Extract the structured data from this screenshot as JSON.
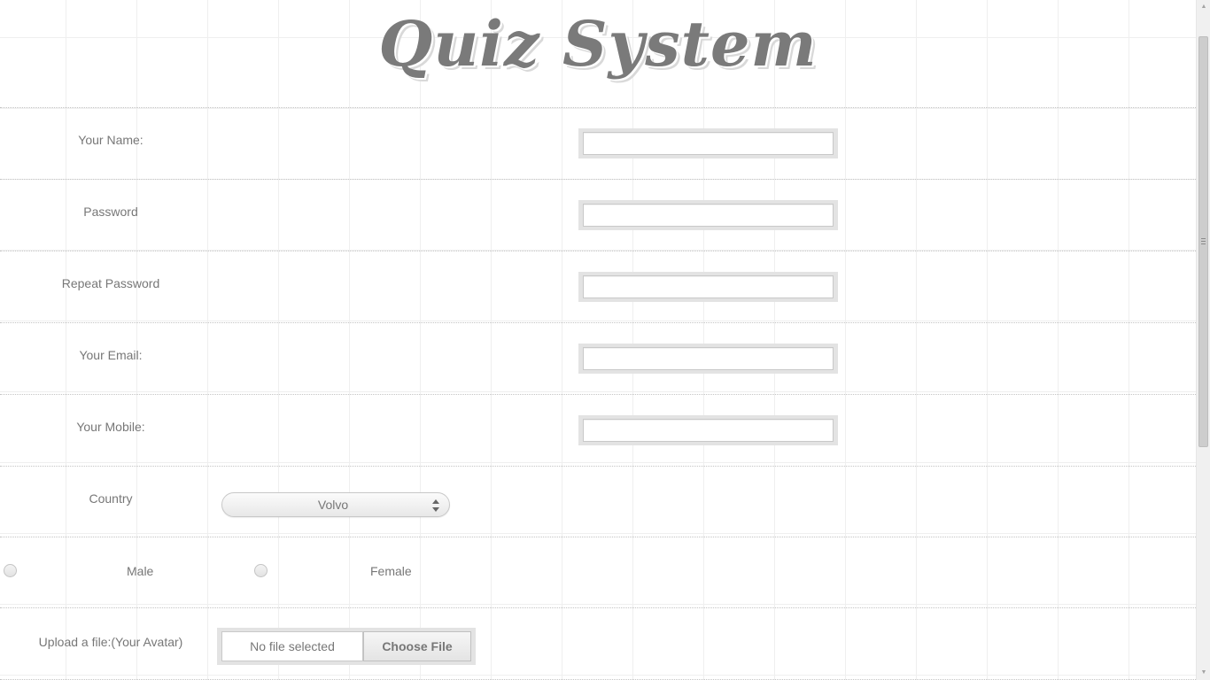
{
  "header": {
    "title": "Quiz System"
  },
  "form": {
    "name_label": "Your Name:",
    "name_value": "",
    "password_label": "Password",
    "password_value": "",
    "repeat_password_label": "Repeat Password",
    "repeat_password_value": "",
    "email_label": "Your Email:",
    "email_value": "",
    "mobile_label": "Your Mobile:",
    "mobile_value": "",
    "country_label": "Country",
    "country_selected": "Volvo",
    "gender_options": [
      "Male",
      "Female"
    ],
    "gender_selected": null,
    "upload_label": "Upload a file:(Your Avatar)",
    "file_status": "No file selected",
    "file_button_label": "Choose File"
  },
  "icons": {
    "select_arrows": "select-updown-icon",
    "scroll_up": "scroll-up-arrow-icon",
    "scroll_down": "scroll-down-arrow-icon"
  },
  "colors": {
    "text": "#777777",
    "title": "#7a7a7a",
    "input_frame": "#e3e3e3",
    "grid_line": "#efefef"
  }
}
